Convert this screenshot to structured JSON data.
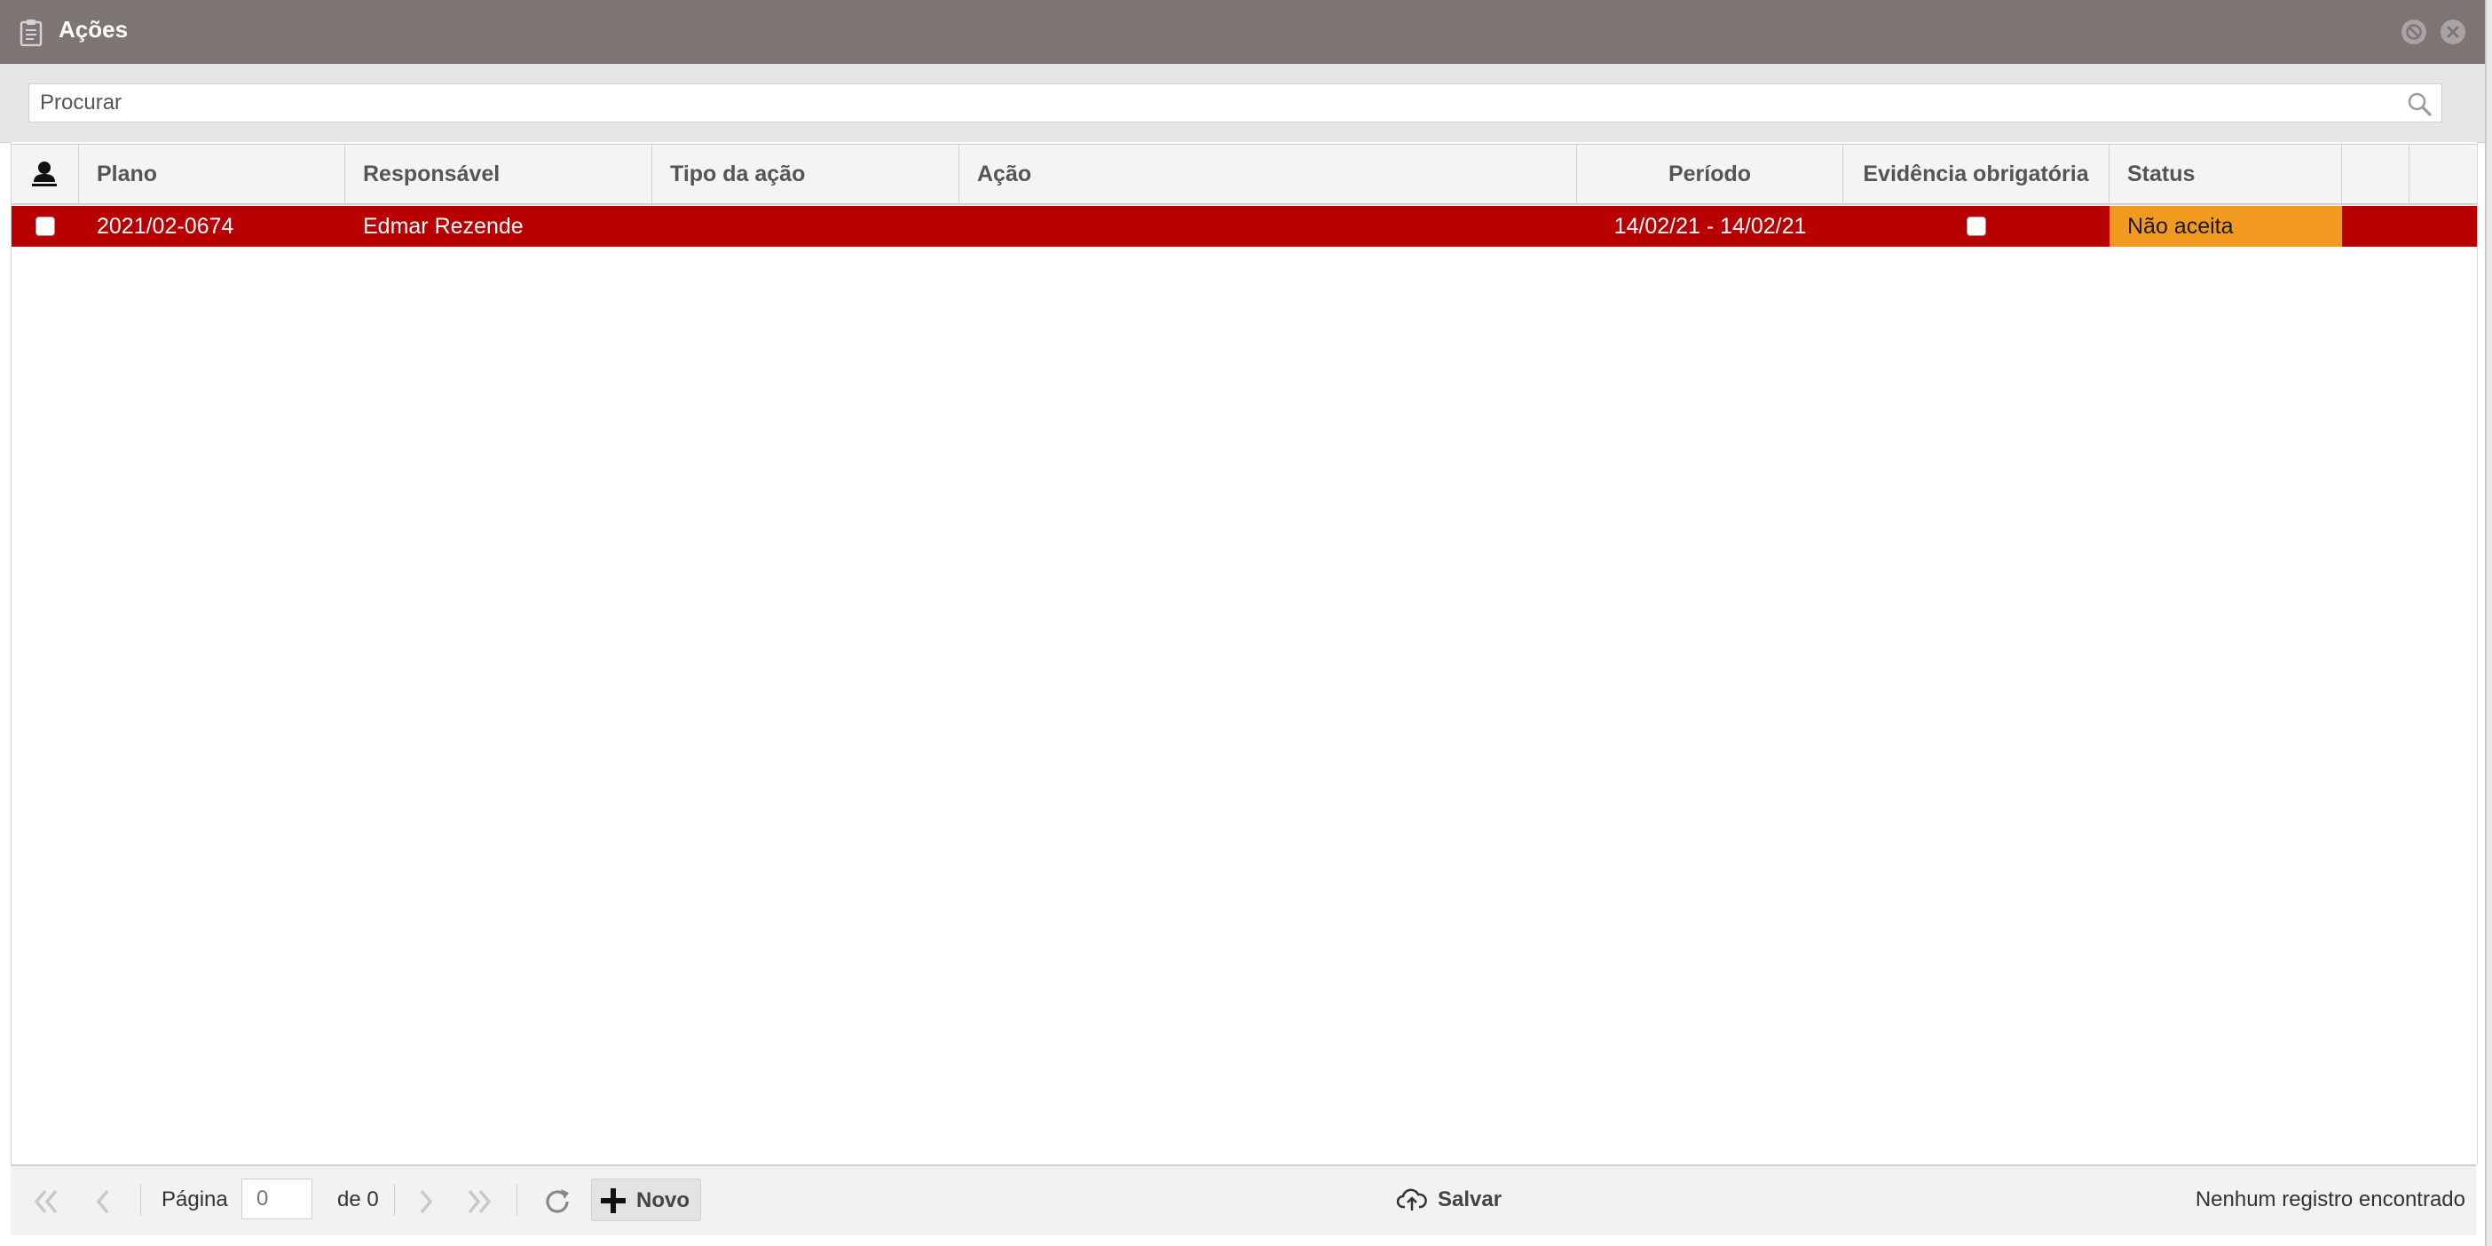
{
  "window": {
    "title": "Ações",
    "title_icon": "clipboard-icon",
    "buttons": [
      "minimize-icon",
      "close-icon"
    ],
    "titlebar_color": "#7d7474"
  },
  "search": {
    "placeholder": "Procurar",
    "icon": "search-icon"
  },
  "table": {
    "header_icon": "user-icon",
    "columns": [
      "Plano",
      "Responsável",
      "Tipo da ação",
      "Ação",
      "Período",
      "Evidência obrigatória",
      "Status"
    ],
    "rows": [
      {
        "plano": "2021/02-0674",
        "responsavel": "Edmar Rezende",
        "tipo_acao": "",
        "acao": "",
        "periodo": "14/02/21 - 14/02/21",
        "evidencia_obrigatoria": false,
        "status": "Não aceita",
        "selected": false,
        "row_color": "#b80000",
        "status_color": "#f29a20"
      }
    ]
  },
  "footer": {
    "page_label": "Página",
    "page_value": "0",
    "page_total": "de 0",
    "new_label": "Novo",
    "save_label": "Salvar",
    "status_message": "Nenhum registro encontrado"
  }
}
